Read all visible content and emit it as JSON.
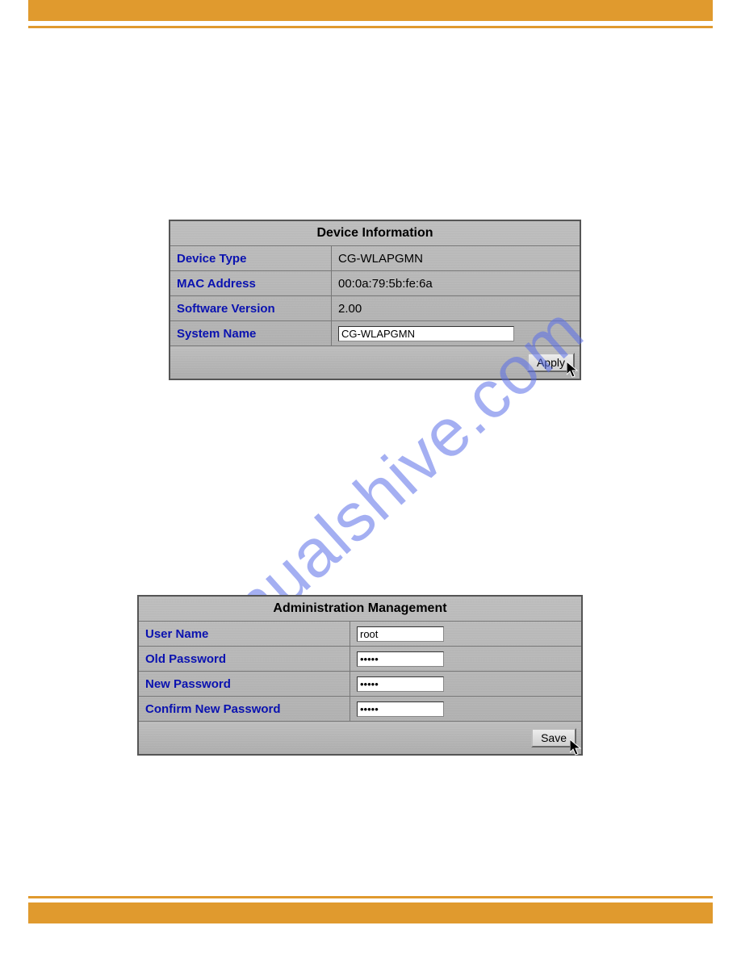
{
  "watermark_text": "manualshive.com",
  "panel1": {
    "title": "Device Information",
    "rows": [
      {
        "label": "Device Type",
        "value": "CG-WLAPGMN"
      },
      {
        "label": "MAC Address",
        "value": "00:0a:79:5b:fe:6a"
      },
      {
        "label": "Software Version",
        "value": "2.00"
      }
    ],
    "system_name_label": "System Name",
    "system_name_value": "CG-WLAPGMN",
    "apply_label": "Apply"
  },
  "panel2": {
    "title": "Administration Management",
    "rows": [
      {
        "label": "User Name",
        "value": "root",
        "type": "text"
      },
      {
        "label": "Old Password",
        "value": "*****",
        "type": "password"
      },
      {
        "label": "New Password",
        "value": "*****",
        "type": "password"
      },
      {
        "label": "Confirm New Password",
        "value": "*****",
        "type": "password"
      }
    ],
    "save_label": "Save"
  }
}
